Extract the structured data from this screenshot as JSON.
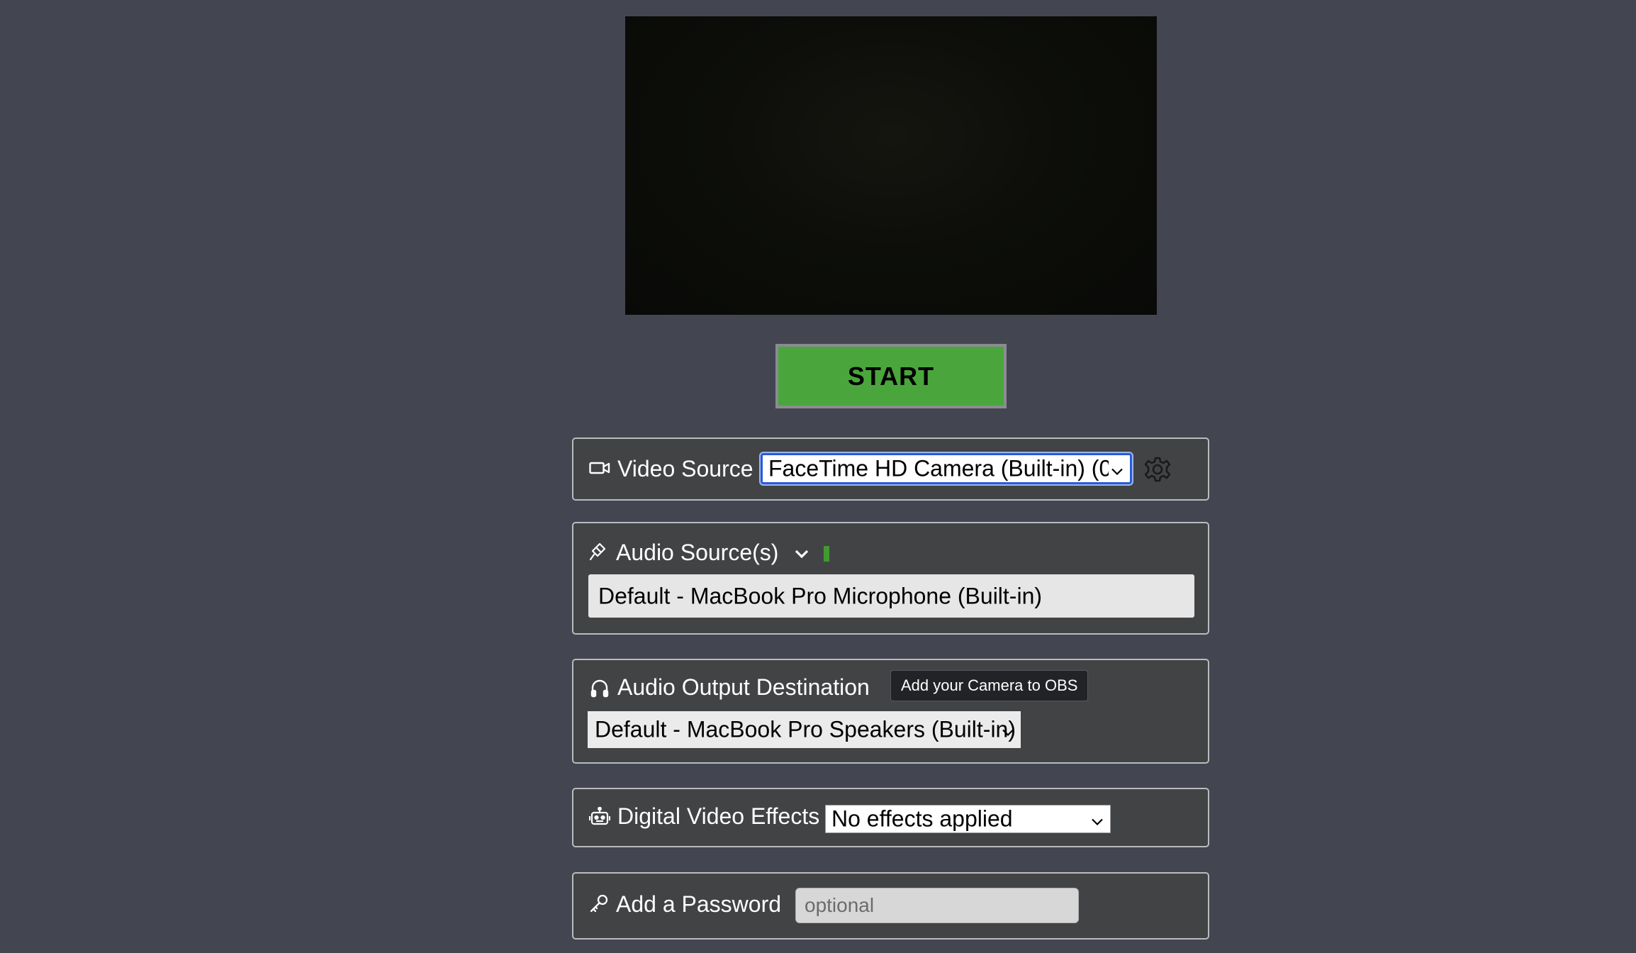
{
  "preview": {
    "label": ""
  },
  "start_button": {
    "label": "START",
    "color": "#4aa63c"
  },
  "video_source": {
    "label": "Video Source",
    "selected": "FaceTime HD Camera (Built-in) (0",
    "icon": "video-camera-icon",
    "settings_icon": "gear-icon"
  },
  "audio_sources": {
    "label": "Audio Source(s)",
    "icon": "microphone-icon",
    "toggle_icon": "chevron-down-icon",
    "selected": "Default - MacBook Pro Microphone (Built-in)",
    "level_color": "#3f9a2f"
  },
  "audio_output": {
    "label": "Audio Output Destination",
    "icon": "headphones-icon",
    "selected": "Default - MacBook Pro Speakers (Built-in)"
  },
  "tooltip": {
    "text": "Add your Camera to OBS"
  },
  "video_effects": {
    "label": "Digital Video Effects",
    "icon": "robot-icon",
    "selected": "No effects applied"
  },
  "password": {
    "label": "Add a Password",
    "icon": "key-icon",
    "placeholder": "optional"
  }
}
